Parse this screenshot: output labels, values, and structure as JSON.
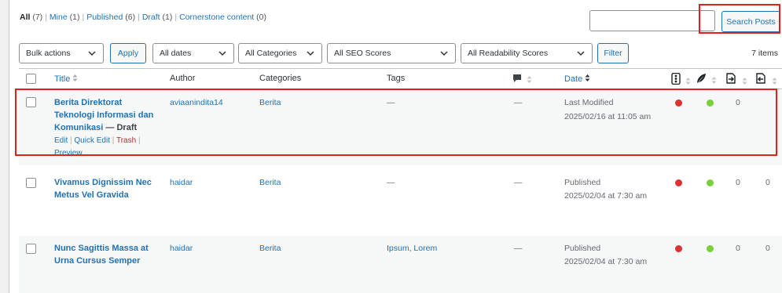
{
  "views": [
    {
      "label": "All",
      "count": "(7)"
    },
    {
      "label": "Mine",
      "count": "(1)"
    },
    {
      "label": "Published",
      "count": "(6)"
    },
    {
      "label": "Draft",
      "count": "(1)"
    },
    {
      "label": "Cornerstone content",
      "count": "(0)"
    }
  ],
  "search": {
    "value": "",
    "button_label": "Search Posts"
  },
  "tablenav": {
    "bulk_actions": "Bulk actions",
    "apply_label": "Apply",
    "dates": "All dates",
    "categories": "All Categories",
    "seo_scores": "All SEO Scores",
    "readability_scores": "All Readability Scores",
    "filter_label": "Filter",
    "items_count": "7 items"
  },
  "columns": {
    "title": "Title",
    "author": "Author",
    "categories": "Categories",
    "tags": "Tags",
    "date": "Date"
  },
  "rows": [
    {
      "title": "Berita Direktorat Teknologi Informasi dan Komunikasi",
      "state": "— Draft",
      "author": "aviaanindita14",
      "category": "Berita",
      "tags": "—",
      "comments": "—",
      "date_status": "Last Modified",
      "date_value": "2025/02/16 at 11:05 am",
      "seo": "red",
      "readability": "green",
      "outgoing_links": "0",
      "incoming_links": "",
      "actions": {
        "edit": "Edit",
        "quick_edit": "Quick Edit",
        "trash": "Trash",
        "preview": "Preview"
      }
    },
    {
      "title": "Vivamus Dignissim Nec Metus Vel Gravida",
      "state": "",
      "author": "haidar",
      "category": "Berita",
      "tags": "—",
      "comments": "—",
      "date_status": "Published",
      "date_value": "2025/02/04 at 7:30 am",
      "seo": "red",
      "readability": "green",
      "outgoing_links": "0",
      "incoming_links": "0"
    },
    {
      "title": "Nunc Sagittis Massa at Urna Cursus Semper",
      "state": "",
      "author": "haidar",
      "category": "Berita",
      "tags": "Ipsum, Lorem",
      "comments": "—",
      "date_status": "Published",
      "date_value": "2025/02/04 at 7:30 am",
      "seo": "red",
      "readability": "green",
      "outgoing_links": "0",
      "incoming_links": "0"
    }
  ],
  "colors": {
    "link": "#2271b1",
    "seo_red": "#dc3232",
    "readability_green": "#7ad03a",
    "highlight": "#e0201c"
  }
}
